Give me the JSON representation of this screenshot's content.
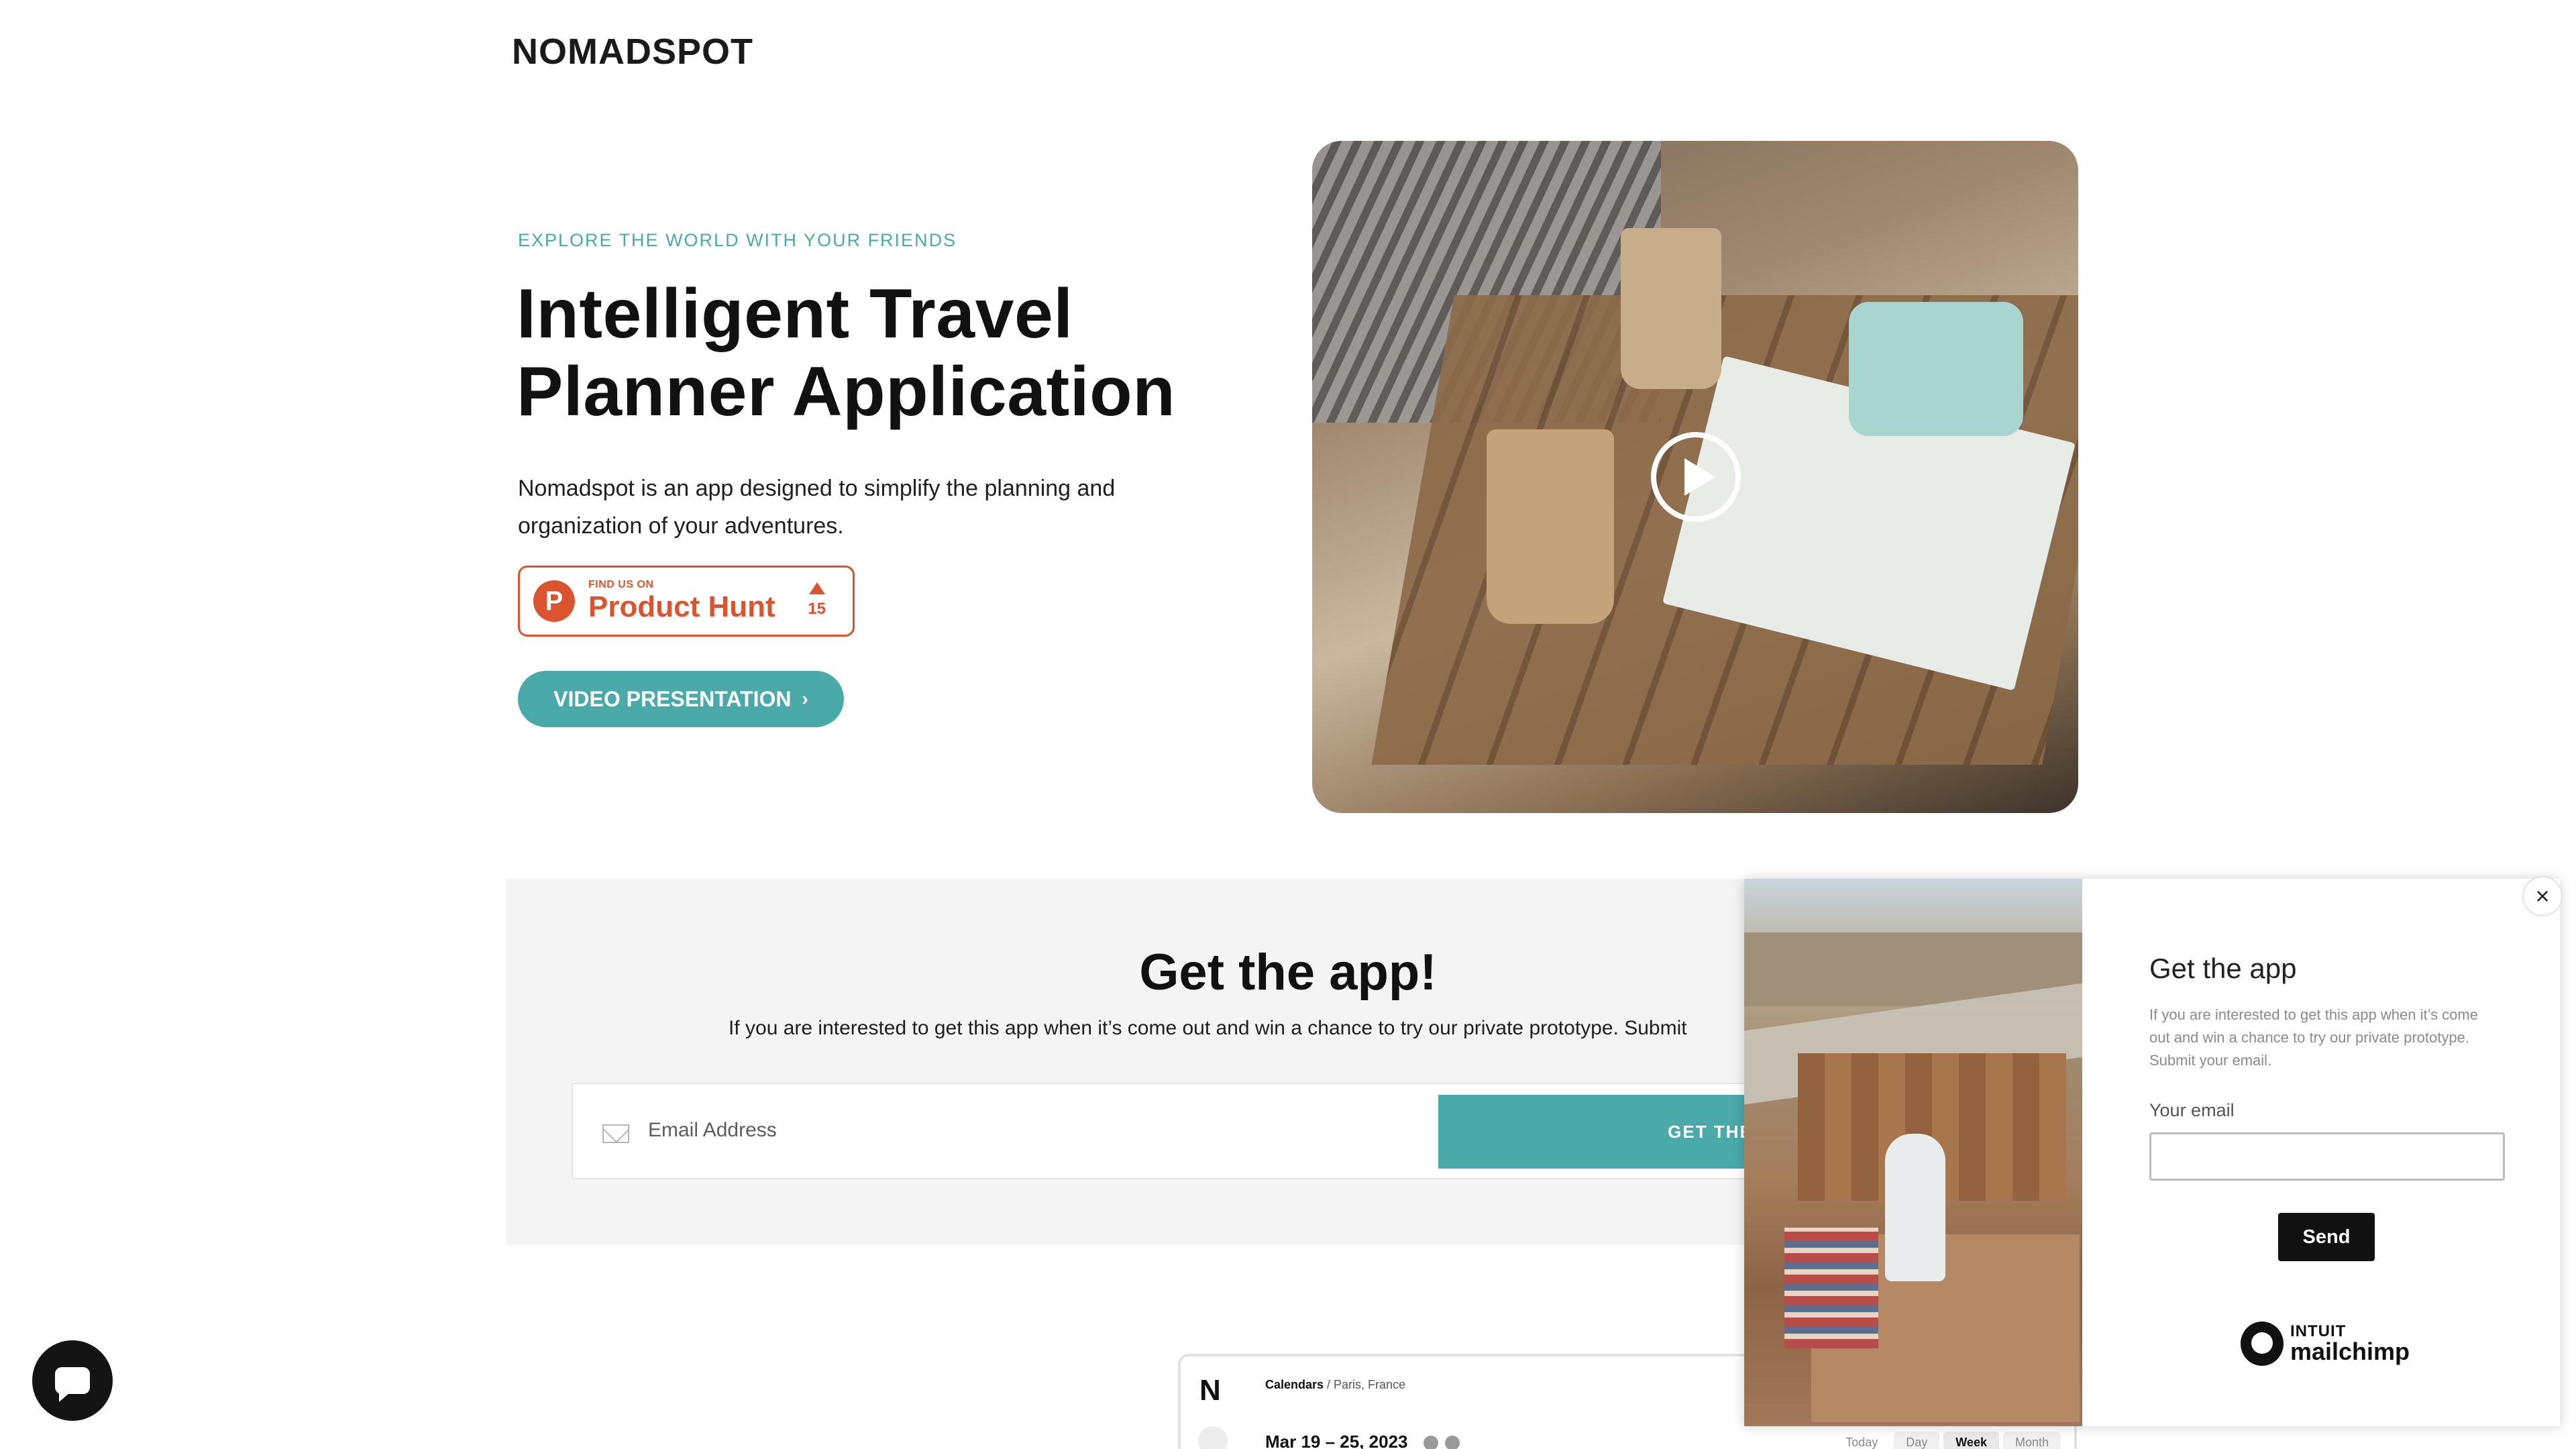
{
  "header": {
    "logo": "NOMADSPOT"
  },
  "hero": {
    "eyebrow": "EXPLORE THE WORLD WITH YOUR FRIENDS",
    "title_line1": "Intelligent Travel",
    "title_line2": "Planner Application",
    "description": "Nomadspot is an app designed to simplify the planning and organization of your adventures.",
    "product_hunt": {
      "small": "FIND US ON",
      "name": "Product Hunt",
      "logo_letter": "P",
      "votes": "15"
    },
    "video_button": "VIDEO PRESENTATION",
    "video_icon": "play-icon"
  },
  "get_app": {
    "title": "Get the app!",
    "subtitle": "If you are interested to get this app when it’s come out and win a chance to try our private prototype. Submit",
    "email_placeholder": "Email Address",
    "button": "GET THE A"
  },
  "calendar_preview": {
    "logo": "N",
    "crumb_strong": "Calendars",
    "crumb_rest": " / Paris, France",
    "range": "Mar 19 – 25, 2023",
    "views": [
      "Today",
      "Day",
      "Week",
      "Month"
    ],
    "active_view": "Week"
  },
  "popup": {
    "title": "Get the app",
    "description": "If you are interested to get this app when it’s come out and win a chance to try our private prototype. Submit your email.",
    "email_label": "Your email",
    "send": "Send",
    "close": "×",
    "brand_top": "INTUIT",
    "brand_bottom": "mailchimp"
  },
  "colors": {
    "accent": "#4aa9a9",
    "product_hunt": "#da552f",
    "dark": "#111111"
  }
}
